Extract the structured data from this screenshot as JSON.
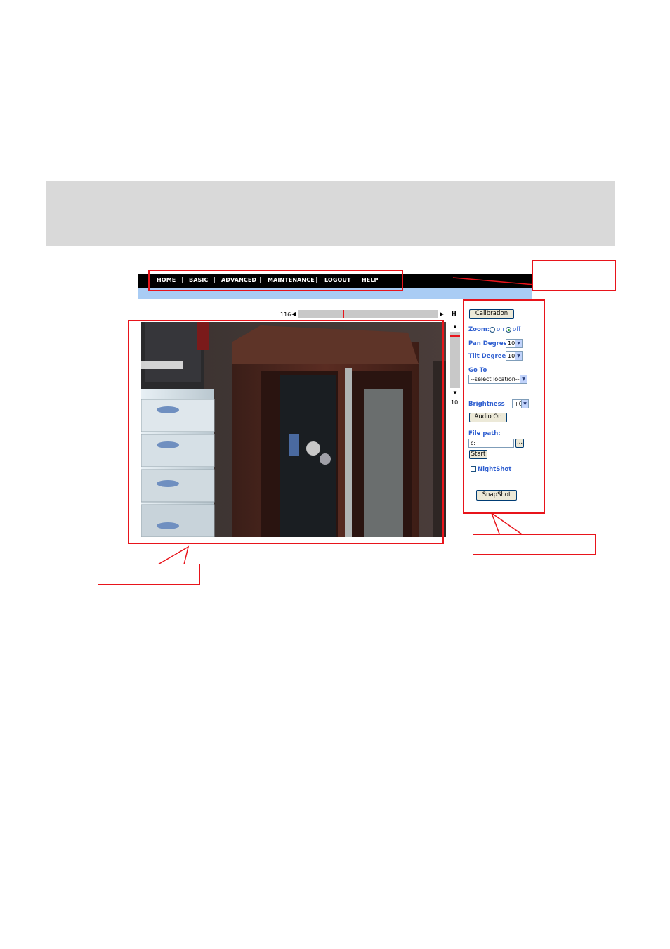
{
  "nav": {
    "items": [
      "HOME",
      "BASIC",
      "ADVANCED",
      "MAINTENANCE",
      "LOGOUT",
      "HELP"
    ],
    "separator": "|"
  },
  "pan": {
    "value": "116",
    "left_arrow": "◀",
    "right_arrow": "▶",
    "h_label": "H",
    "position": 0.32
  },
  "tilt": {
    "value": "10",
    "up_arrow": "▲",
    "down_arrow": "▼",
    "position": 0.05
  },
  "panel": {
    "calibration_label": "Calibration",
    "zoom_label": "Zoom:",
    "zoom_on": "on",
    "zoom_off": "off",
    "zoom_selected": "off",
    "pan_degree_label": "Pan Degree",
    "pan_degree_value": "10",
    "tilt_degree_label": "Tilt Degree",
    "tilt_degree_value": "10",
    "goto_label": "Go To",
    "goto_value": "--select location--",
    "brightness_label": "Brightness",
    "brightness_value": "+0",
    "audio_label": "Audio On",
    "file_path_label": "File path:",
    "file_path_value": "c:",
    "browse_label": "...",
    "start_label": "Start",
    "nightshot_label": "NightShot",
    "snapshot_label": "SnapShot"
  },
  "colors": {
    "annotation_red": "#e8141b",
    "nav_bg": "#000000",
    "nav_sub_bg": "#a9ccf4",
    "panel_label": "#2f5fd0"
  }
}
